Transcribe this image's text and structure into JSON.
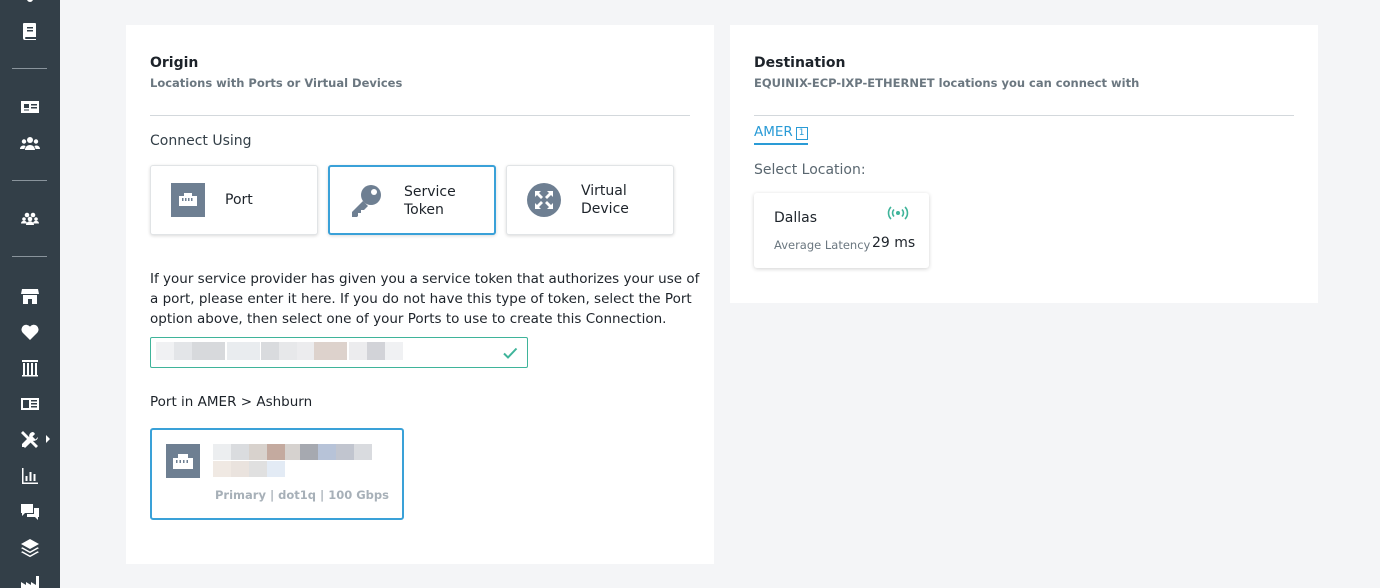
{
  "origin": {
    "title": "Origin",
    "subtitle": "Locations with Ports or Virtual Devices",
    "connect_label": "Connect Using",
    "options": [
      {
        "label_line1": "Port",
        "label_line2": "",
        "icon": "port-icon"
      },
      {
        "label_line1": "Service",
        "label_line2": "Token",
        "icon": "key-icon",
        "selected": true
      },
      {
        "label_line1": "Virtual",
        "label_line2": "Device",
        "icon": "virtual-device-icon"
      }
    ],
    "help_text": "If your service provider has given you a service token that authorizes your use of a port, please enter it here. If you do not have this type of token, select the Port option above, then select one of your Ports to use to create this Connection.",
    "token_status_icon": "check-icon",
    "port_in_label": "Port in AMER > Ashburn",
    "port_card": {
      "meta": "Primary | dot1q | 100 Gbps",
      "icon": "port-icon"
    }
  },
  "destination": {
    "title": "Destination",
    "subtitle": "EQUINIX-ECP-IXP-ETHERNET locations you can connect with",
    "region_tab": "AMER",
    "region_count": "1",
    "select_location_label": "Select Location:",
    "location": {
      "city": "Dallas",
      "latency_label": "Average Latency",
      "latency_value": "29 ms",
      "icon": "signal-icon"
    }
  },
  "colors": {
    "accent": "#3aa1d8",
    "success": "#3fb49a",
    "sidebar": "#333f48"
  }
}
